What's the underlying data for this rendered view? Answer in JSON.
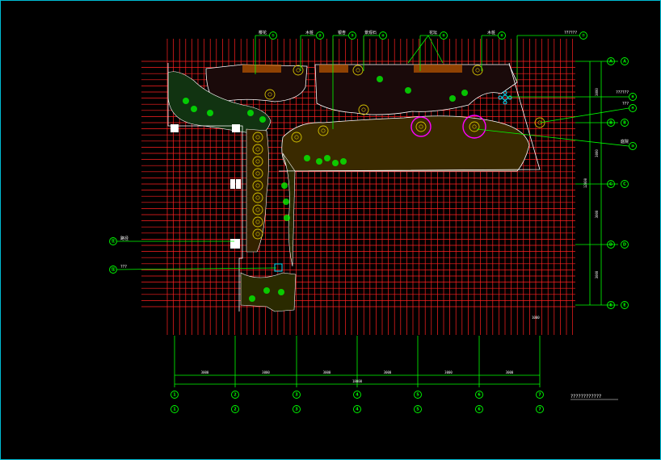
{
  "drawing": {
    "title_block": "????????????",
    "colors": {
      "background": "#000000",
      "grid": "#ff2020",
      "leader": "#00ff00",
      "planting": "#00ff00",
      "paving": "#ffffff",
      "border": "#00bcd4",
      "highlight": "#ff00ff",
      "cyan_symbol": "#00e5ff"
    },
    "scale_note": "1000"
  },
  "top_callouts": [
    {
      "text": "樱花",
      "num": "①"
    },
    {
      "text": "木桩",
      "num": "②"
    },
    {
      "text": "银杏",
      "num": "③"
    },
    {
      "text": "景观石",
      "num": "④"
    },
    {
      "text": "花坛",
      "num": "⑤"
    },
    {
      "text": "木桩",
      "num": "⑥"
    },
    {
      "text": "??????",
      "num": "⑦"
    }
  ],
  "right_callouts": [
    {
      "text": "??????",
      "num": "⑧"
    },
    {
      "text": "???",
      "num": "⑨"
    },
    {
      "text": "庭院",
      "num": "⑩"
    }
  ],
  "left_callouts": [
    {
      "text": "路径",
      "num": "⑪"
    },
    {
      "text": "???",
      "num": "⑫"
    }
  ],
  "bottom_dims": {
    "segments": [
      "3000",
      "3000",
      "3000",
      "3000",
      "3000",
      "3000"
    ],
    "total": "18000",
    "axis_upper": [
      "1",
      "2",
      "3",
      "4",
      "5",
      "6",
      "7"
    ],
    "axis_lower": [
      "1",
      "2",
      "3",
      "4",
      "5",
      "6",
      "7"
    ]
  },
  "right_dims": {
    "segments": [
      "3000",
      "3000",
      "3000",
      "3000"
    ],
    "total": "12000",
    "axis": [
      "A",
      "B",
      "C",
      "D",
      "E"
    ]
  }
}
